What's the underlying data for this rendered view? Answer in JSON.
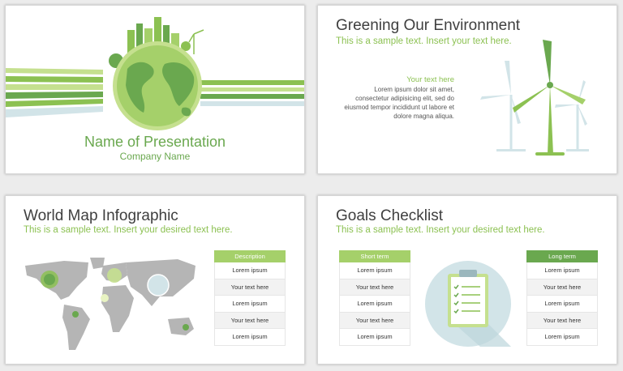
{
  "colors": {
    "accent_green": "#8cc152",
    "dark_green": "#6aa84f",
    "light_green": "#c5e08f",
    "pale_blue": "#d2e4e8",
    "map_gray": "#b5b5b5"
  },
  "slides": [
    {
      "name": "Name of Presentation",
      "company": "Company Name"
    },
    {
      "title": "Greening Our Environment",
      "subtitle": "This is a sample text. Insert your text here.",
      "heading": "Your text here",
      "body": "Lorem ipsum dolor sit amet, consectetur adipisicing elit, sed do eiusmod tempor incididunt ut labore et dolore magna aliqua."
    },
    {
      "title": "World Map Infographic",
      "subtitle": "This is a sample text. Insert your desired text here.",
      "table": {
        "header": "Description",
        "rows": [
          "Lorem ipsum",
          "Your text here",
          "Lorem ipsum",
          "Your text here",
          "Lorem ipsum"
        ]
      }
    },
    {
      "title": "Goals Checklist",
      "subtitle": "This is a sample text. Insert your desired text here.",
      "short_term": {
        "header": "Short term",
        "rows": [
          "Lorem ipsum",
          "Your text here",
          "Lorem ipsum",
          "Your text here",
          "Lorem ipsum"
        ]
      },
      "long_term": {
        "header": "Long term",
        "rows": [
          "Lorem ipsum",
          "Your text here",
          "Lorem ipsum",
          "Your text here",
          "Lorem ipsum"
        ]
      }
    }
  ]
}
